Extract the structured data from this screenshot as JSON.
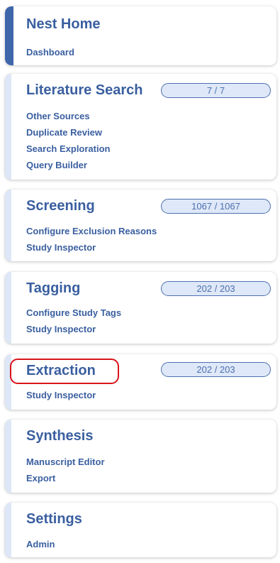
{
  "nav": {
    "nest_home": {
      "title": "Nest Home",
      "links": [
        "Dashboard"
      ]
    },
    "literature_search": {
      "title": "Literature Search",
      "badge": "7 / 7",
      "links": [
        "Other Sources",
        "Duplicate Review",
        "Search Exploration",
        "Query Builder"
      ]
    },
    "screening": {
      "title": "Screening",
      "badge": "1067 / 1067",
      "links": [
        "Configure Exclusion Reasons",
        "Study Inspector"
      ]
    },
    "tagging": {
      "title": "Tagging",
      "badge": "202 / 203",
      "links": [
        "Configure Study Tags",
        "Study Inspector"
      ]
    },
    "extraction": {
      "title": "Extraction",
      "badge": "202 / 203",
      "links": [
        "Study Inspector"
      ]
    },
    "synthesis": {
      "title": "Synthesis",
      "links": [
        "Manuscript Editor",
        "Export"
      ]
    },
    "settings": {
      "title": "Settings",
      "links": [
        "Admin"
      ]
    }
  },
  "colors": {
    "link_text": "#3a5fa0",
    "active_accent": "#3f66ab",
    "inactive_accent": "#dde7f7",
    "badge_border": "#4c6fb0",
    "badge_fill": "#dfe8f8",
    "highlight": "#d9141b"
  }
}
